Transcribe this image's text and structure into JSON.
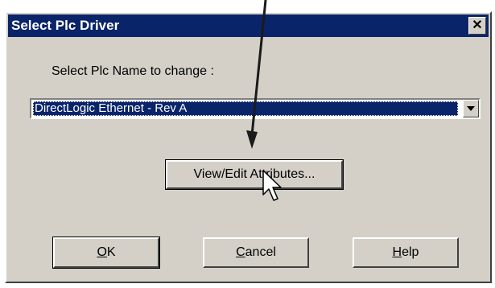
{
  "window": {
    "title": "Select Plc Driver",
    "close_glyph": "✕"
  },
  "prompt": {
    "label": "Select Plc Name to change :"
  },
  "plc_select": {
    "selected_value": "DirectLogic  Ethernet - Rev A"
  },
  "buttons": {
    "view_edit": "View/Edit Attributes...",
    "ok_mnemonic": "O",
    "ok_rest": "K",
    "cancel_mnemonic": "C",
    "cancel_rest": "ancel",
    "help_mnemonic": "H",
    "help_rest": "elp"
  },
  "colors": {
    "titlebar": "#0a246a",
    "dialog_face": "#d4d0c8",
    "selection": "#0a246a"
  },
  "icons": {
    "close": "close-icon",
    "dropdown": "dropdown-arrow-icon",
    "cursor": "mouse-pointer-icon",
    "annotation": "annotation-arrow"
  }
}
